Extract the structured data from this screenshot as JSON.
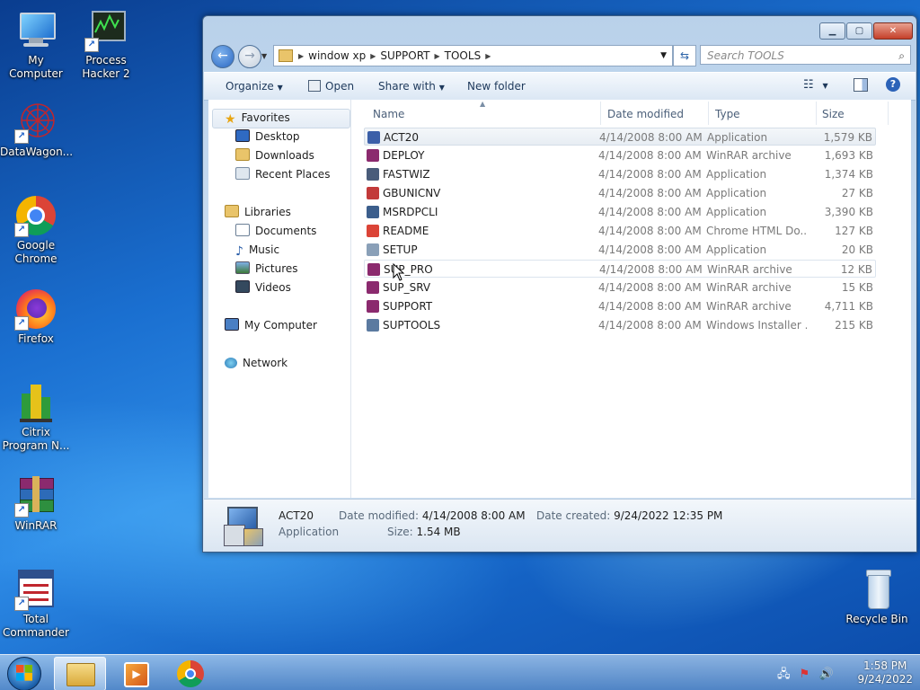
{
  "desktop": {
    "icons": [
      {
        "label": "My Computer"
      },
      {
        "label": "Process Hacker 2"
      },
      {
        "label": "DataWagon..."
      },
      {
        "label": "Google Chrome"
      },
      {
        "label": "Firefox"
      },
      {
        "label": "Citrix Program N..."
      },
      {
        "label": "WinRAR"
      },
      {
        "label": "Total Commander"
      },
      {
        "label": "Recycle Bin"
      }
    ]
  },
  "window": {
    "controls": {
      "minimize": "▁",
      "maximize": "▢",
      "close": "✕"
    },
    "address": {
      "segments": [
        "window xp",
        "SUPPORT",
        "TOOLS"
      ]
    },
    "search_placeholder": "Search TOOLS",
    "toolbar": {
      "organize": "Organize",
      "open": "Open",
      "share_with": "Share with",
      "new_folder": "New folder"
    },
    "nav": {
      "favorites": "Favorites",
      "desktop": "Desktop",
      "downloads": "Downloads",
      "recent": "Recent Places",
      "libraries": "Libraries",
      "documents": "Documents",
      "music": "Music",
      "pictures": "Pictures",
      "videos": "Videos",
      "my_computer": "My Computer",
      "network": "Network"
    },
    "columns": {
      "name": "Name",
      "date": "Date modified",
      "type": "Type",
      "size": "Size"
    },
    "files": [
      {
        "name": "ACT20",
        "date": "4/14/2008 8:00 AM",
        "type": "Application",
        "size": "1,579 KB",
        "color": "#3b5fa8"
      },
      {
        "name": "DEPLOY",
        "date": "4/14/2008 8:00 AM",
        "type": "WinRAR archive",
        "size": "1,693 KB",
        "color": "#8b2a6e"
      },
      {
        "name": "FASTWIZ",
        "date": "4/14/2008 8:00 AM",
        "type": "Application",
        "size": "1,374 KB",
        "color": "#4a5c7a"
      },
      {
        "name": "GBUNICNV",
        "date": "4/14/2008 8:00 AM",
        "type": "Application",
        "size": "27 KB",
        "color": "#c23a3a"
      },
      {
        "name": "MSRDPCLI",
        "date": "4/14/2008 8:00 AM",
        "type": "Application",
        "size": "3,390 KB",
        "color": "#3c5e8c"
      },
      {
        "name": "README",
        "date": "4/14/2008 8:00 AM",
        "type": "Chrome HTML Do...",
        "size": "127 KB",
        "color": "#db4437"
      },
      {
        "name": "SETUP",
        "date": "4/14/2008 8:00 AM",
        "type": "Application",
        "size": "20 KB",
        "color": "#8aa0b8"
      },
      {
        "name": "SUP_PRO",
        "date": "4/14/2008 8:00 AM",
        "type": "WinRAR archive",
        "size": "12 KB",
        "color": "#8b2a6e"
      },
      {
        "name": "SUP_SRV",
        "date": "4/14/2008 8:00 AM",
        "type": "WinRAR archive",
        "size": "15 KB",
        "color": "#8b2a6e"
      },
      {
        "name": "SUPPORT",
        "date": "4/14/2008 8:00 AM",
        "type": "WinRAR archive",
        "size": "4,711 KB",
        "color": "#8b2a6e"
      },
      {
        "name": "SUPTOOLS",
        "date": "4/14/2008 8:00 AM",
        "type": "Windows Installer ...",
        "size": "215 KB",
        "color": "#5b7aa0"
      }
    ],
    "details": {
      "name": "ACT20",
      "kind": "Application",
      "date_modified_label": "Date modified:",
      "date_modified": "4/14/2008 8:00 AM",
      "date_created_label": "Date created:",
      "date_created": "9/24/2022 12:35 PM",
      "size_label": "Size:",
      "size": "1.54 MB"
    }
  },
  "taskbar": {
    "time": "1:58 PM",
    "date": "9/24/2022"
  }
}
